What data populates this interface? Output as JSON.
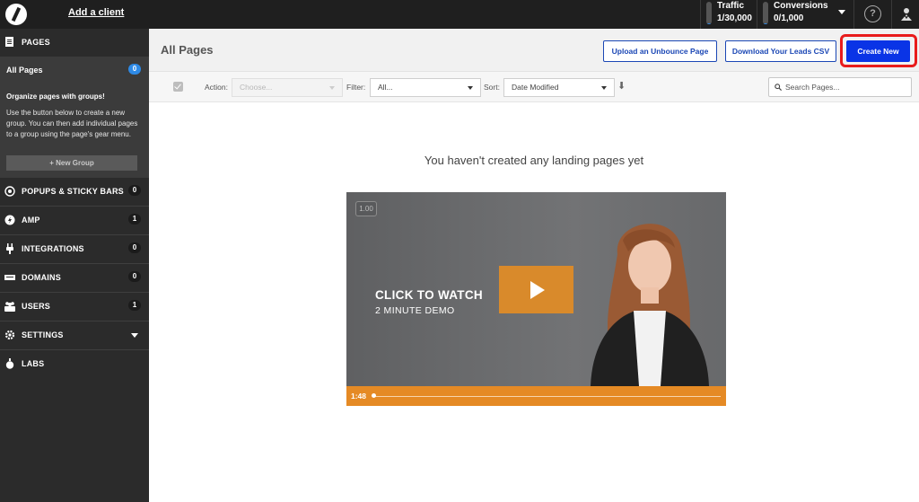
{
  "topbar": {
    "add_client": "Add a client",
    "traffic_label": "Traffic",
    "traffic_value": "1/30,000",
    "traffic_fraction": 0.04,
    "conversions_label": "Conversions",
    "conversions_value": "0/1,000",
    "conversions_fraction": 0.04,
    "help": "?"
  },
  "sidebar": {
    "pages_heading": "PAGES",
    "all_pages": "All Pages",
    "all_pages_count": "0",
    "groups_note_title": "Organize pages with groups!",
    "groups_note_body": "Use the button below to create a new group. You can then add individual pages to a group using the page's gear menu.",
    "new_group": "+ New Group",
    "items": [
      {
        "label": "POPUPS & STICKY BARS",
        "count": "0"
      },
      {
        "label": "AMP",
        "count": "1"
      },
      {
        "label": "INTEGRATIONS",
        "count": "0"
      },
      {
        "label": "DOMAINS",
        "count": "0"
      },
      {
        "label": "USERS",
        "count": "1"
      },
      {
        "label": "SETTINGS",
        "count": ""
      },
      {
        "label": "LABS",
        "count": ""
      }
    ]
  },
  "header": {
    "title": "All Pages",
    "upload_btn": "Upload an Unbounce Page",
    "download_btn": "Download Your Leads CSV",
    "create_btn": "Create New"
  },
  "filters": {
    "action_label": "Action:",
    "action_value": "Choose...",
    "filter_label": "Filter:",
    "filter_value": "All...",
    "sort_label": "Sort:",
    "sort_value": "Date Modified",
    "sort_dir": "⬇",
    "search_placeholder": "Search Pages..."
  },
  "main": {
    "empty_message": "You haven't created any landing pages yet"
  },
  "video": {
    "speed": "1.00",
    "cta_title": "CLICK TO WATCH",
    "cta_sub": "2 MINUTE DEMO",
    "duration": "1:48"
  },
  "colors": {
    "accent": "#0a34e6",
    "highlight": "#e81b1b",
    "video_orange": "#e58a25"
  }
}
